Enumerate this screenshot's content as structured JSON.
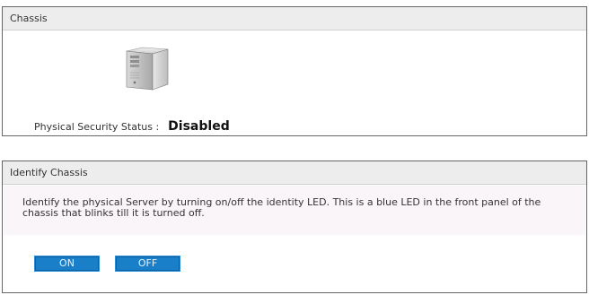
{
  "chassis": {
    "header": "Chassis",
    "icon": "server-tower-icon",
    "status_label": "Physical Security Status :",
    "status_value": "Disabled"
  },
  "identify": {
    "header": "Identify Chassis",
    "description": "Identify the physical Server by turning on/off the identity LED. This is a blue LED in the front panel of the chassis that blinks till it is turned off.",
    "on_label": "ON",
    "off_label": "OFF"
  },
  "colors": {
    "button_blue": "#1a7fc9",
    "header_bg": "#ededed",
    "desc_bg": "#f9f5f8"
  }
}
